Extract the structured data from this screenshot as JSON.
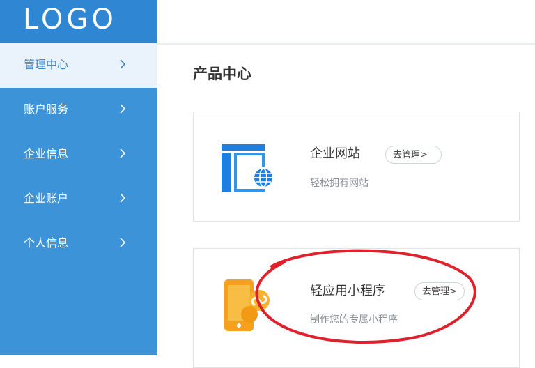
{
  "logo": {
    "text": "LOGO"
  },
  "sidebar": {
    "items": [
      {
        "label": "管理中心",
        "active": true
      },
      {
        "label": "账户服务",
        "active": false
      },
      {
        "label": "企业信息",
        "active": false
      },
      {
        "label": "企业账户",
        "active": false
      },
      {
        "label": "个人信息",
        "active": false
      }
    ]
  },
  "main": {
    "title": "产品中心",
    "products": [
      {
        "title": "企业网站",
        "button": "去管理>",
        "description": "轻松拥有网站",
        "icon": "website-globe-icon"
      },
      {
        "title": "轻应用小程序",
        "button": "去管理>",
        "description": "制作您的专属小程序",
        "icon": "mini-program-phone-icon"
      }
    ]
  },
  "colors": {
    "sidebar": "#3d93d8",
    "logo_bg": "#2f86d2",
    "active_bg": "#eaf2fb",
    "active_text": "#3a86cf",
    "annotation_red": "#e0202a",
    "website_icon_blue": "#1f7fe0",
    "mini_program_orange": "#f5a11c"
  }
}
